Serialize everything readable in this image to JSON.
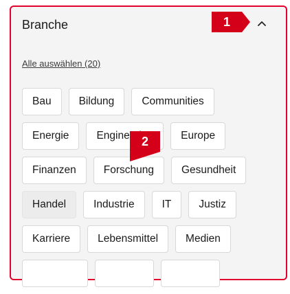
{
  "panel": {
    "title": "Branche",
    "select_all": "Alle auswählen (20)",
    "accent_color": "#e2002d",
    "collapse_icon": "chevron-up-icon"
  },
  "markers": [
    "1",
    "2"
  ],
  "chips": [
    [
      "Bau",
      "Bildung",
      "Communities"
    ],
    [
      "Energie",
      "Engineering",
      "Europe"
    ],
    [
      "Finanzen",
      "Forschung",
      "Gesundheit"
    ],
    [
      "Handel",
      "Industrie",
      "IT",
      "Justiz"
    ],
    [
      "Karriere",
      "Lebensmittel",
      "Medien"
    ]
  ],
  "selected_chip": "Handel"
}
